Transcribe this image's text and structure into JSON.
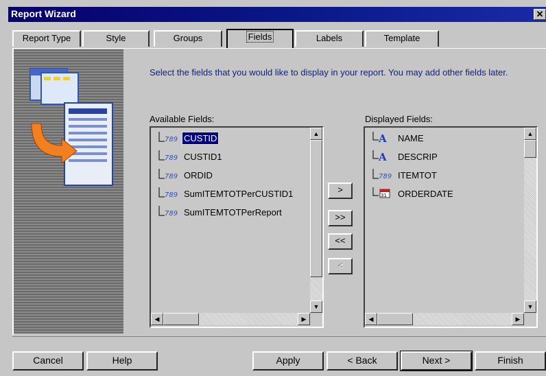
{
  "window": {
    "title": "Report Wizard",
    "close_glyph": "✕"
  },
  "tabs": [
    {
      "label": "Report Type",
      "active": false
    },
    {
      "label": "Style",
      "active": false
    },
    {
      "label": "Groups",
      "active": false
    },
    {
      "label": "Fields",
      "active": true
    },
    {
      "label": "Labels",
      "active": false
    },
    {
      "label": "Template",
      "active": false
    }
  ],
  "instructions": "Select the fields that you would like to display in your report. You may add other fields later.",
  "available": {
    "label": "Available Fields:",
    "items": [
      {
        "name": "CUSTID",
        "icon": "number-field-icon",
        "selected": true
      },
      {
        "name": "CUSTID1",
        "icon": "number-field-icon",
        "selected": false
      },
      {
        "name": "ORDID",
        "icon": "number-field-icon",
        "selected": false
      },
      {
        "name": "SumITEMTOTPerCUSTID1",
        "icon": "number-field-icon",
        "selected": false
      },
      {
        "name": "SumITEMTOTPerReport",
        "icon": "number-field-icon",
        "selected": false
      }
    ]
  },
  "displayed": {
    "label": "Displayed Fields:",
    "items": [
      {
        "name": "NAME",
        "icon": "text-field-icon"
      },
      {
        "name": "DESCRIP",
        "icon": "text-field-icon"
      },
      {
        "name": "ITEMTOT",
        "icon": "number-field-icon"
      },
      {
        "name": "ORDERDATE",
        "icon": "date-field-icon"
      }
    ]
  },
  "move_buttons": {
    "add_one": ">",
    "add_all": ">>",
    "remove_all": "<<",
    "remove_one": "<"
  },
  "buttons": {
    "cancel": "Cancel",
    "help": "Help",
    "apply": "Apply",
    "back": "< Back",
    "next": "Next >",
    "finish": "Finish"
  },
  "icon_text": {
    "number": "789",
    "text": "A",
    "date": "31"
  }
}
